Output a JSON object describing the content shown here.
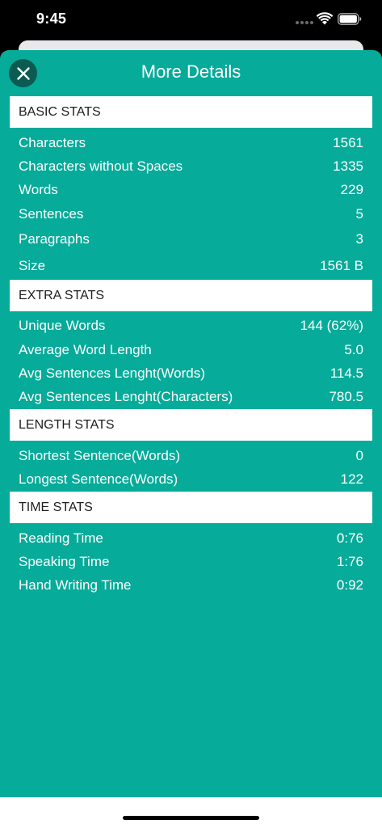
{
  "status_bar": {
    "time": "9:45"
  },
  "sheet": {
    "title": "More Details"
  },
  "sections": [
    {
      "header": "BASIC STATS",
      "rows": [
        {
          "label": "Characters",
          "value": "1561"
        },
        {
          "label": "Characters without Spaces",
          "value": "1335"
        },
        {
          "label": "Words",
          "value": "229"
        },
        {
          "label": "Sentences",
          "value": "5"
        },
        {
          "label": "Paragraphs",
          "value": "3"
        },
        {
          "label": "Size",
          "value": "1561 B"
        }
      ]
    },
    {
      "header": "EXTRA STATS",
      "rows": [
        {
          "label": "Unique Words",
          "value": "144 (62%)"
        },
        {
          "label": "Average Word Length",
          "value": "5.0"
        },
        {
          "label": "Avg Sentences Lenght(Words)",
          "value": "114.5"
        },
        {
          "label": "Avg Sentences Lenght(Characters)",
          "value": "780.5"
        }
      ]
    },
    {
      "header": "LENGTH STATS",
      "rows": [
        {
          "label": "Shortest Sentence(Words)",
          "value": "0"
        },
        {
          "label": "Longest Sentence(Words)",
          "value": "122"
        }
      ]
    },
    {
      "header": "TIME STATS",
      "rows": [
        {
          "label": "Reading Time",
          "value": "0:76"
        },
        {
          "label": "Speaking Time",
          "value": "1:76"
        },
        {
          "label": "Hand Writing Time",
          "value": "0:92"
        }
      ]
    }
  ],
  "icons": {
    "close": "close-icon",
    "wifi": "wifi-icon",
    "battery": "battery-icon",
    "signal": "signal-dots-icon"
  },
  "colors": {
    "sheet_background": "#06ab9a",
    "close_button": "#0b5b52",
    "section_header_background": "#ffffff",
    "text_on_sheet": "#ffffff"
  }
}
